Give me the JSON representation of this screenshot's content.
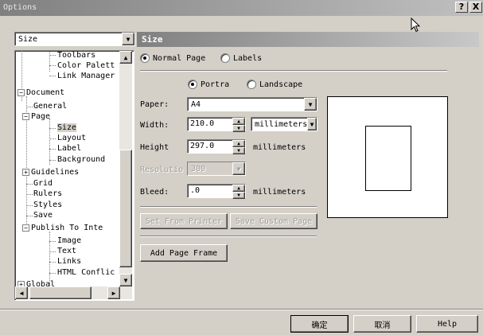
{
  "window": {
    "title": "Options",
    "help_glyph": "?",
    "close_glyph": "X"
  },
  "category_select": {
    "value": "Size"
  },
  "tree": {
    "items": [
      {
        "label": "Toolbars"
      },
      {
        "label": "Color Palett"
      },
      {
        "label": "Link Manager"
      },
      {
        "label": "Document"
      },
      {
        "label": "General"
      },
      {
        "label": "Page"
      },
      {
        "label": "Size"
      },
      {
        "label": "Layout"
      },
      {
        "label": "Label"
      },
      {
        "label": "Background"
      },
      {
        "label": "Guidelines"
      },
      {
        "label": "Grid"
      },
      {
        "label": "Rulers"
      },
      {
        "label": "Styles"
      },
      {
        "label": "Save"
      },
      {
        "label": "Publish To Inte"
      },
      {
        "label": "Image"
      },
      {
        "label": "Text"
      },
      {
        "label": "Links"
      },
      {
        "label": "HTML Conflic"
      },
      {
        "label": "Global"
      }
    ]
  },
  "section": {
    "title": "Size"
  },
  "page_type": {
    "normal": "Normal Page",
    "labels": "Labels"
  },
  "orientation": {
    "portrait": "Portra",
    "landscape": "Landscape"
  },
  "fields": {
    "paper_label": "Paper:",
    "paper_value": "A4",
    "width_label": "Width:",
    "width_value": "210.0",
    "width_units": "millimeters",
    "height_label": "Height",
    "height_value": "297.0",
    "height_units": "millimeters",
    "resolution_label": "Resolutio",
    "resolution_value": "300",
    "bleed_label": "Bleed:",
    "bleed_value": ".0",
    "bleed_units": "millimeters"
  },
  "buttons": {
    "set_from_printer": "Set From Printer",
    "save_custom_page": "Save Custom Page",
    "add_page_frame": "Add Page Frame",
    "ok": "确定",
    "cancel": "取消",
    "help": "Help"
  }
}
